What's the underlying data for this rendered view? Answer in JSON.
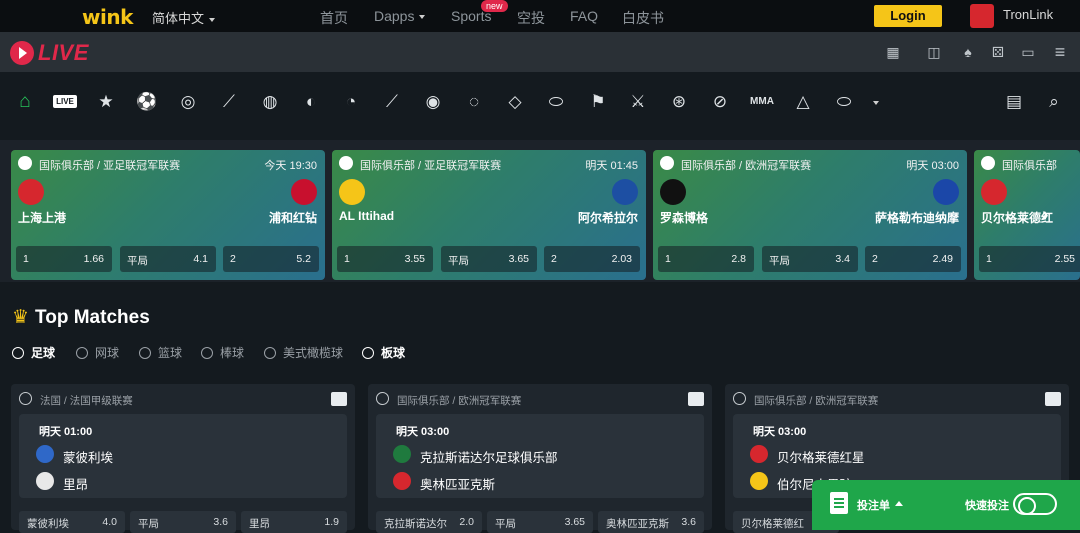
{
  "topnav": {
    "logo": "wink",
    "language": "简体中文",
    "links": [
      "首页",
      "Dapps",
      "Sports",
      "空投",
      "FAQ",
      "白皮书"
    ],
    "new_badge": "new",
    "login": "Login",
    "wallet": "TronLink"
  },
  "subbar": {
    "brand": "LIVE",
    "icons": [
      "slot-machine-icon",
      "arcade-icon",
      "poker-chips-icon",
      "dice-icon",
      "wallet-icon",
      "menu-icon"
    ]
  },
  "sportbar": {
    "live_label": "LIVE",
    "icons": [
      "home-icon",
      "live-icon",
      "star-icon",
      "soccer-icon",
      "tennis-icon",
      "hockey-icon",
      "basketball-icon",
      "volleyball-icon",
      "baseball-icon",
      "cricket-icon",
      "golf-icon",
      "table-tennis-icon",
      "badminton-icon",
      "rugby-icon",
      "racing-flag-icon",
      "esports-icon",
      "cycling-icon",
      "squash-icon",
      "mma-icon",
      "billiards-icon",
      "american-football-icon",
      "more-icon",
      "betslip-list-icon",
      "search-icon"
    ],
    "mma_label": "MMA"
  },
  "featured": [
    {
      "league": "国际俱乐部 / 亚足联冠军联赛",
      "time": "今天 19:30",
      "home": "上海上港",
      "away": "浦和红钻",
      "odds": [
        [
          "1",
          "1.66"
        ],
        [
          "平局",
          "4.1"
        ],
        [
          "2",
          "5.2"
        ]
      ],
      "home_color": "#d6272e",
      "away_color": "#c8102e"
    },
    {
      "league": "国际俱乐部 / 亚足联冠军联赛",
      "time": "明天 01:45",
      "home": "AL Ittihad",
      "away": "阿尔希拉尔",
      "odds": [
        [
          "1",
          "3.55"
        ],
        [
          "平局",
          "3.65"
        ],
        [
          "2",
          "2.03"
        ]
      ],
      "home_color": "#f5c518",
      "away_color": "#1d4fa3"
    },
    {
      "league": "国际俱乐部 / 欧洲冠军联赛",
      "time": "明天 03:00",
      "home": "罗森博格",
      "away": "萨格勒布迪纳摩",
      "odds": [
        [
          "1",
          "2.8"
        ],
        [
          "平局",
          "3.4"
        ],
        [
          "2",
          "2.49"
        ]
      ],
      "home_color": "#111111",
      "away_color": "#1b47a8"
    },
    {
      "league": "国际俱乐部",
      "time": "",
      "home": "贝尔格莱德红",
      "away": "",
      "odds": [
        [
          "1",
          "2.55"
        ]
      ],
      "home_color": "#d6272e",
      "away_color": ""
    }
  ],
  "top_matches": {
    "title": "Top Matches",
    "tabs": [
      "足球",
      "网球",
      "篮球",
      "棒球",
      "美式橄榄球",
      "板球"
    ]
  },
  "matches": [
    {
      "league": "法国 / 法国甲级联赛",
      "time": "明天 01:00",
      "team1": "蒙彼利埃",
      "team2": "里昂",
      "odds": [
        [
          "蒙彼利埃",
          "4.0"
        ],
        [
          "平局",
          "3.6"
        ],
        [
          "里昂",
          "1.9"
        ]
      ],
      "c1": "#2f68c8",
      "c2": "#e8e8e8"
    },
    {
      "league": "国际俱乐部 / 欧洲冠军联赛",
      "time": "明天 03:00",
      "team1": "克拉斯诺达尔足球俱乐部",
      "team2": "奥林匹亚克斯",
      "odds": [
        [
          "克拉斯诺达尔",
          "2.0"
        ],
        [
          "平局",
          "3.65"
        ],
        [
          "奥林匹亚克斯",
          "3.6"
        ]
      ],
      "c1": "#1f7a3e",
      "c2": "#d6272e"
    },
    {
      "league": "国际俱乐部 / 欧洲冠军联赛",
      "time": "明天 03:00",
      "team1": "贝尔格莱德红星",
      "team2": "伯尔尼小男孩",
      "odds": [
        [
          "贝尔格莱德红",
          "",
          ""
        ]
      ],
      "c1": "#d6272e",
      "c2": "#f5c518"
    }
  ],
  "betslip": {
    "label": "投注单",
    "quick": "快速投注"
  }
}
